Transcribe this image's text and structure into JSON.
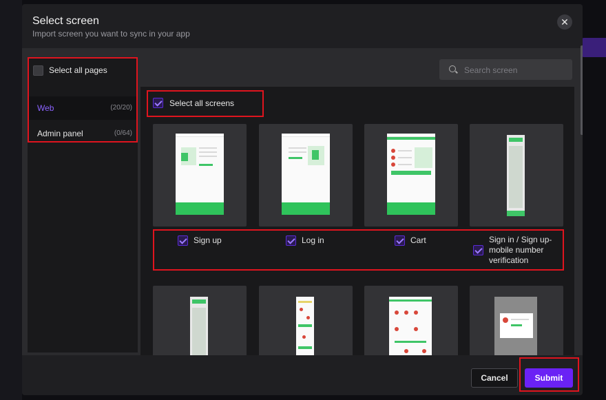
{
  "dialog": {
    "title": "Select screen",
    "subtitle": "Import screen you want to sync in your app",
    "close_icon": "close-icon"
  },
  "pages": {
    "select_all_label": "Select all pages",
    "items": [
      {
        "name": "Web",
        "count": "(20/20)",
        "active": true
      },
      {
        "name": "Admin panel",
        "count": "(0/64)",
        "active": false
      }
    ]
  },
  "search": {
    "placeholder": "Search screen",
    "value": ""
  },
  "screens": {
    "select_all_label": "Select all screens",
    "select_all_checked": true,
    "items": [
      {
        "label": "Sign up",
        "checked": true
      },
      {
        "label": "Log in",
        "checked": true
      },
      {
        "label": "Cart",
        "checked": true
      },
      {
        "label": "Sign in / Sign up- mobile number verification",
        "checked": true
      }
    ]
  },
  "footer": {
    "cancel_label": "Cancel",
    "submit_label": "Submit"
  },
  "colors": {
    "accent": "#6a22f5",
    "active_page_text": "#8b63ff",
    "annotation": "#e0141e",
    "thumbnail_green": "#2fc35b"
  }
}
